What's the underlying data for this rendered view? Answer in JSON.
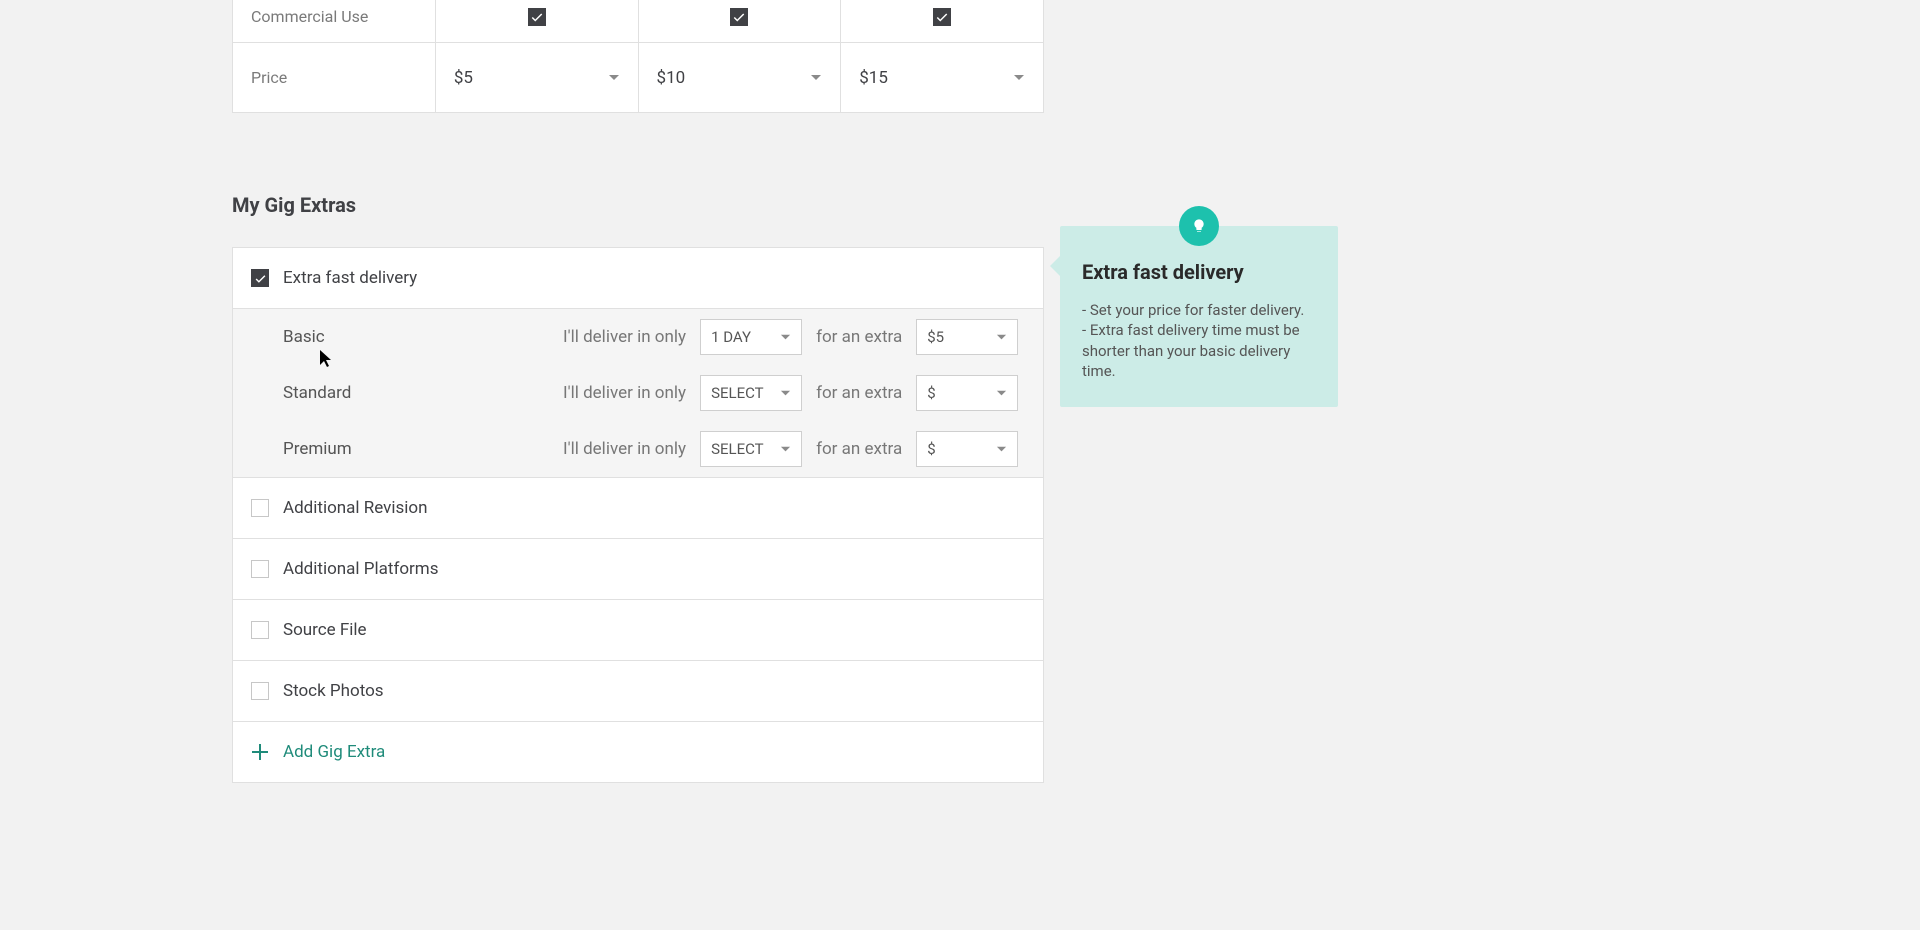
{
  "pricing": {
    "commercial_use_label": "Commercial Use",
    "price_label": "Price",
    "tier1": {
      "commercial": true,
      "price": "$5"
    },
    "tier2": {
      "commercial": true,
      "price": "$10"
    },
    "tier3": {
      "commercial": true,
      "price": "$15"
    }
  },
  "extras": {
    "heading": "My Gig Extras",
    "fast": {
      "label": "Extra fast delivery",
      "checked": true,
      "lead": "I'll deliver in only",
      "for_extra": "for an extra",
      "tiers": [
        {
          "name": "Basic",
          "delivery": "1 DAY",
          "price": "$5"
        },
        {
          "name": "Standard",
          "delivery": "SELECT",
          "price": "$"
        },
        {
          "name": "Premium",
          "delivery": "SELECT",
          "price": "$"
        }
      ]
    },
    "options": [
      {
        "label": "Additional Revision",
        "checked": false
      },
      {
        "label": "Additional Platforms",
        "checked": false
      },
      {
        "label": "Source File",
        "checked": false
      },
      {
        "label": "Stock Photos",
        "checked": false
      }
    ],
    "add_label": "Add Gig Extra"
  },
  "tip": {
    "title": "Extra fast delivery",
    "line1": "- Set your price for faster delivery.",
    "line2": "- Extra fast delivery time must be shorter than your basic delivery time."
  }
}
